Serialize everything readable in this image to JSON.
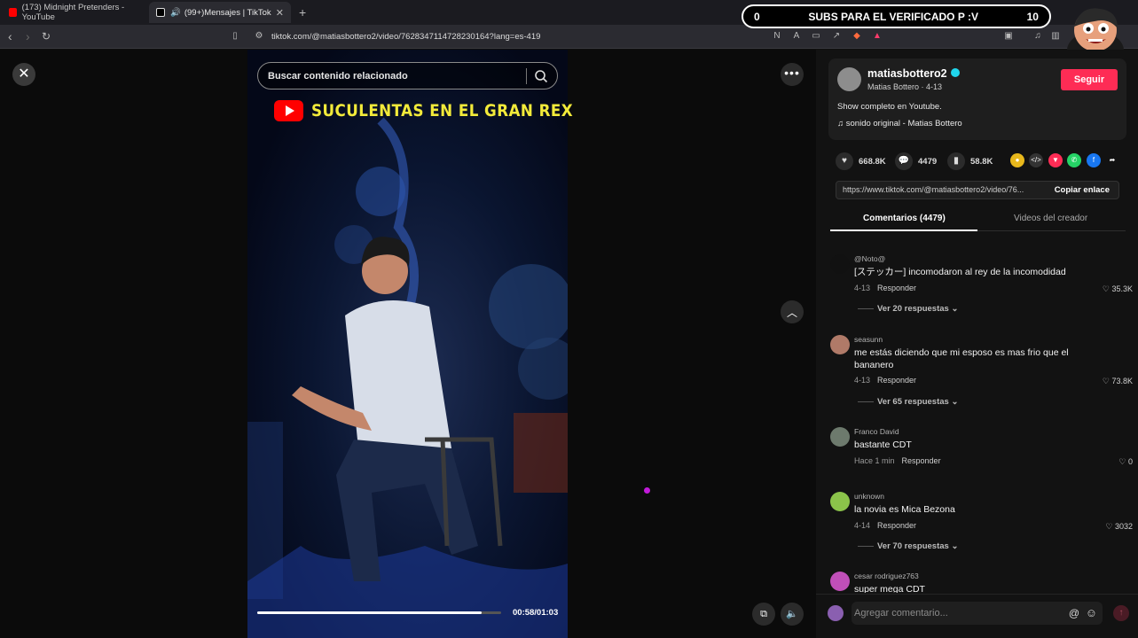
{
  "browser": {
    "tabs": [
      {
        "label": "(173) Midnight Pretenders - YouTube",
        "color": "#ff0000"
      },
      {
        "label": "(99+)Mensajes | TikTok",
        "color": "#ffffff"
      }
    ],
    "new_tab": "+",
    "url": "tiktok.com/@matiasbottero2/video/7628347114728230164?lang=es-419"
  },
  "overlay": {
    "left_count": "0",
    "text": "SUBS PARA EL VERIFICADO P :V",
    "right_count": "10"
  },
  "player": {
    "search_placeholder": "Buscar contenido relacionado",
    "video_title": "SUCULENTAS EN EL GRAN REX",
    "time": "00:58/01:03",
    "progress": 0.92
  },
  "author": {
    "username": "matiasbottero2",
    "subline": "Matias Bottero · 4-13",
    "follow_label": "Seguir",
    "description": "Show completo en Youtube.",
    "sound": "sonido original - Matias Bottero"
  },
  "stats": {
    "likes": "668.8K",
    "comments": "4479",
    "saves": "58.8K"
  },
  "link": {
    "url": "https://www.tiktok.com/@matiasbottero2/video/76...",
    "copy_label": "Copiar enlace"
  },
  "tabs": {
    "comments": "Comentarios (4479)",
    "creator_videos": "Videos del creador"
  },
  "comments": [
    {
      "user": "@Noto@",
      "text": "[ステッカー] incomodaron al rey de la incomodidad",
      "date": "4-13",
      "reply": "Responder",
      "likes": "35.3K",
      "replies": "Ver 20 respuestas ⌄"
    },
    {
      "user": "seasunn",
      "text": "me estás diciendo que mi esposo es mas frio que el bananero",
      "date": "4-13",
      "reply": "Responder",
      "likes": "73.8K",
      "replies": "Ver 65 respuestas ⌄"
    },
    {
      "user": "Franco David",
      "text": "bastante CDT",
      "date": "Hace 1 min",
      "reply": "Responder",
      "likes": "0",
      "replies": ""
    },
    {
      "user": "unknown",
      "text": "la novia es Mica Bezona",
      "date": "4-14",
      "reply": "Responder",
      "likes": "3032",
      "replies": "Ver 70 respuestas ⌄"
    },
    {
      "user": "cesar rodriguez763",
      "text": "super mega CDT",
      "date": "",
      "reply": "",
      "likes": "",
      "replies": ""
    }
  ],
  "composer": {
    "placeholder": "Agregar comentario..."
  }
}
